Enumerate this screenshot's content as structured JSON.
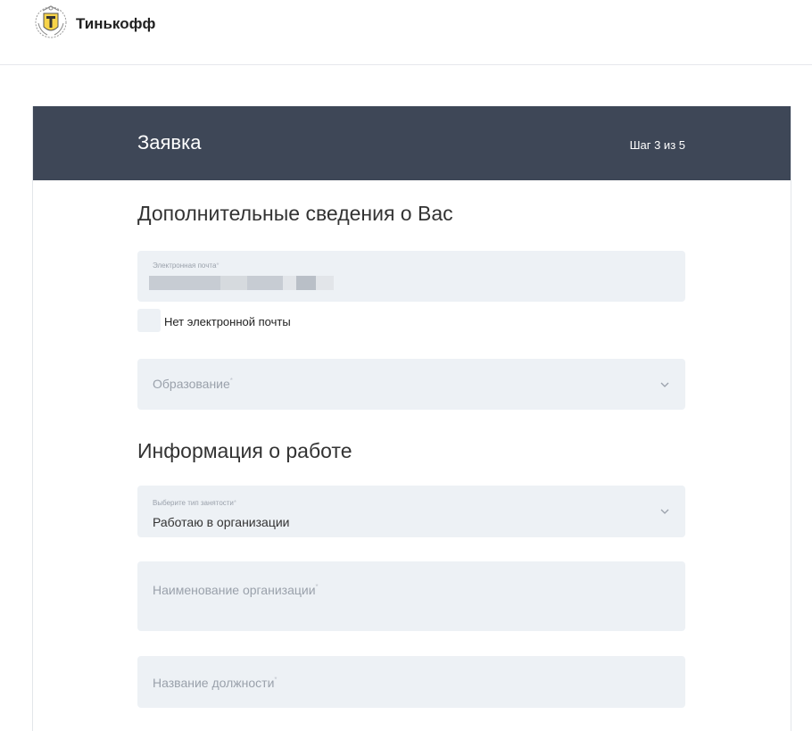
{
  "header": {
    "brand_name": "Тинькофф",
    "logo_icon": "tinkoff-crest-icon"
  },
  "card": {
    "title": "Заявка",
    "step": "Шаг 3 из 5"
  },
  "additional_info": {
    "section_title": "Дополнительные сведения о Вас",
    "email": {
      "label": "Электронная почта",
      "required_mark": "*"
    },
    "no_email_checkbox": {
      "label": "Нет электронной почты",
      "checked": false
    },
    "education": {
      "placeholder": "Образование",
      "required_mark": "*"
    }
  },
  "work_info": {
    "section_title": "Информация о работе",
    "employment_type": {
      "label": "Выберите тип занятости",
      "required_mark": "*",
      "value": "Работаю в организации"
    },
    "organization_name": {
      "placeholder": "Наименование организации",
      "required_mark": "*"
    },
    "position_title": {
      "placeholder": "Название должности",
      "required_mark": "*"
    }
  },
  "colors": {
    "header_bg": "#3e4757",
    "field_bg": "#edf1f5",
    "placeholder": "#9aa1ab",
    "logo_gold": "#f7d44a"
  }
}
